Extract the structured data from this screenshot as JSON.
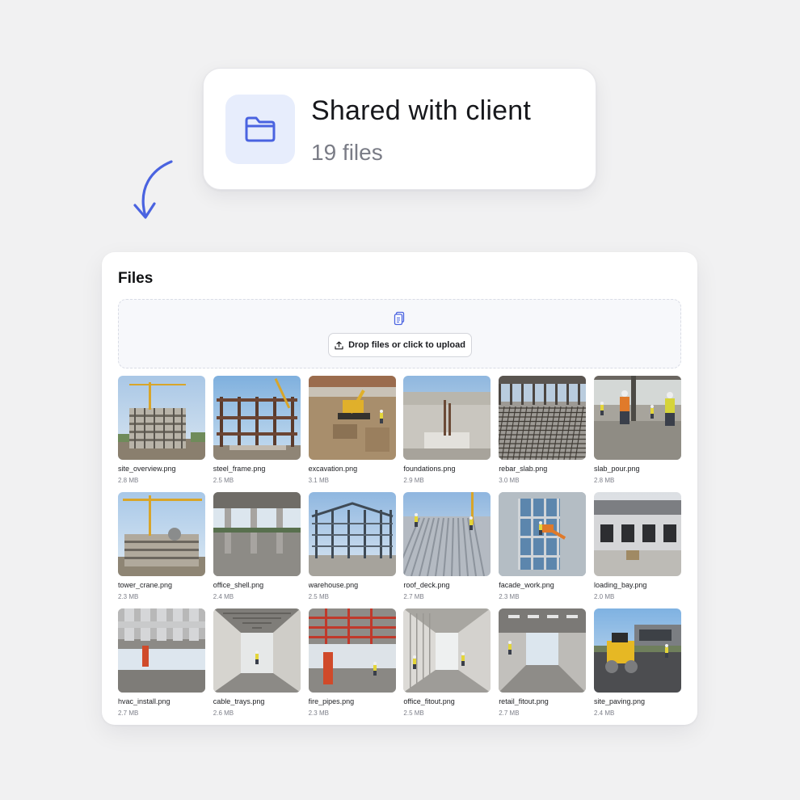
{
  "folder": {
    "title": "Shared with client",
    "count": "19 files",
    "icon": "folder-icon",
    "accent": "#4a63e0"
  },
  "files_panel": {
    "title": "Files",
    "upload_label": "Drop files or click to upload",
    "dropzone_icon": "document-icon",
    "upload_icon": "upload-icon"
  },
  "files": [
    {
      "name": "site_overview.png",
      "size": "2.8 MB",
      "scene": "crane-building"
    },
    {
      "name": "steel_frame.png",
      "size": "2.5 MB",
      "scene": "steel-frame"
    },
    {
      "name": "excavation.png",
      "size": "3.1 MB",
      "scene": "excavator"
    },
    {
      "name": "foundations.png",
      "size": "2.9 MB",
      "scene": "foundation"
    },
    {
      "name": "rebar_slab.png",
      "size": "3.0 MB",
      "scene": "rebar"
    },
    {
      "name": "slab_pour.png",
      "size": "2.8 MB",
      "scene": "workers-concrete"
    },
    {
      "name": "tower_crane.png",
      "size": "2.3 MB",
      "scene": "tower-crane"
    },
    {
      "name": "office_shell.png",
      "size": "2.4 MB",
      "scene": "interior-shell"
    },
    {
      "name": "warehouse.png",
      "size": "2.5 MB",
      "scene": "warehouse-frame"
    },
    {
      "name": "roof_deck.png",
      "size": "2.7 MB",
      "scene": "roof-deck"
    },
    {
      "name": "facade_work.png",
      "size": "2.3 MB",
      "scene": "glass-facade"
    },
    {
      "name": "loading_bay.png",
      "size": "2.0 MB",
      "scene": "loading-bay"
    },
    {
      "name": "hvac_install.png",
      "size": "2.7 MB",
      "scene": "hvac-ducts"
    },
    {
      "name": "cable_trays.png",
      "size": "2.6 MB",
      "scene": "corridor-trays"
    },
    {
      "name": "fire_pipes.png",
      "size": "2.3 MB",
      "scene": "red-pipes"
    },
    {
      "name": "office_fitout.png",
      "size": "2.5 MB",
      "scene": "corridor-fitout"
    },
    {
      "name": "retail_fitout.png",
      "size": "2.7 MB",
      "scene": "retail-interior"
    },
    {
      "name": "site_paving.png",
      "size": "2.4 MB",
      "scene": "roller-paving"
    }
  ]
}
